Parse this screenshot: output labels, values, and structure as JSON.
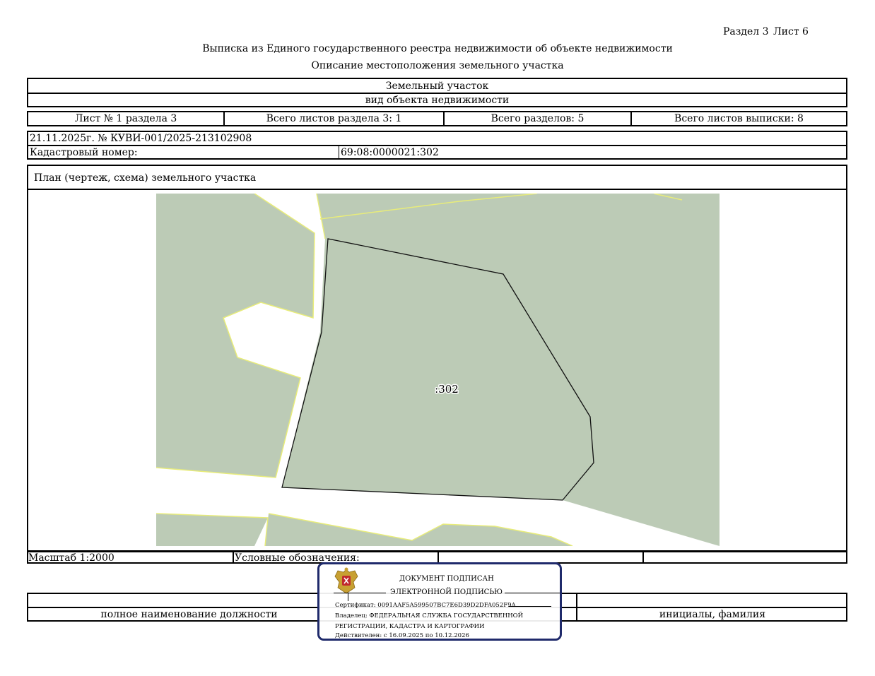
{
  "header": {
    "section_label": "Раздел 3",
    "sheet_label": "Лист 6",
    "title": "Выписка из Единого государственного реестра недвижимости об объекте недвижимости",
    "subtitle": "Описание местоположения земельного участка"
  },
  "object": {
    "type": "Земельный участок",
    "type_caption": "вид объекта недвижимости"
  },
  "sheets_row": {
    "sheet": "Лист № 1 раздела 3",
    "total_sheets_section": "Всего листов раздела 3: 1",
    "total_sections": "Всего разделов: 5",
    "total_sheets_extract": "Всего листов выписки: 8"
  },
  "record": {
    "date_number": "21.11.2025г. № КУВИ-001/2025-213102908",
    "cadastral_label": "Кадастровый номер:",
    "cadastral_number": "69:08:0000021:302"
  },
  "plan": {
    "title": "План (чертеж, схема) земельного участка",
    "parcel_label": ":302",
    "colors": {
      "land": "#bccbb6",
      "border": "#e8ec7a",
      "parcel_outline": "#111111"
    }
  },
  "legend_row": {
    "scale": "Масштаб 1:2000",
    "legend_label": "Условные обозначения:"
  },
  "signature_row": {
    "position_caption": "полное наименование должности",
    "name_caption": "инициалы, фамилия"
  },
  "stamp": {
    "line1": "ДОКУМЕНТ ПОДПИСАН",
    "line2": "ЭЛЕКТРОННОЙ ПОДПИСЬЮ",
    "certificate": "Сертификат: 0091AAF5A599507BC7E6D39D2DFA052F9A",
    "owner": "Владелец: ФЕДЕРАЛЬНАЯ СЛУЖБА ГОСУДАРСТВЕННОЙ",
    "owner_cont": "РЕГИСТРАЦИИ, КАДАСТРА И КАРТОГРАФИИ",
    "valid": "Действителен: с 16.09.2025 по 10.12.2026",
    "emblem_icon": "coat-of-arms-icon",
    "border_color": "#1f2a6b"
  }
}
